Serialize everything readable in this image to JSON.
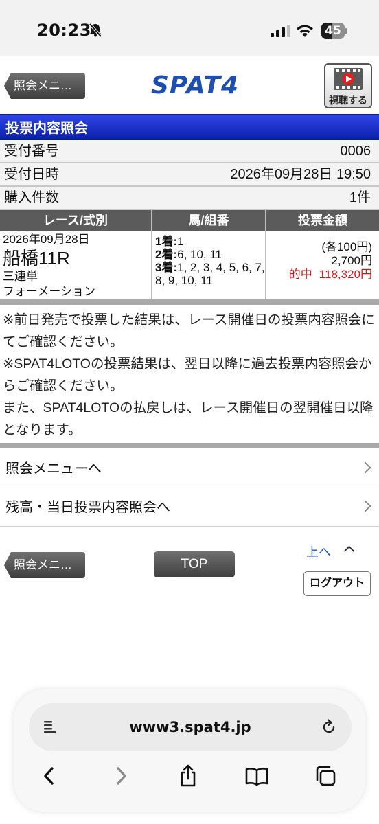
{
  "status_bar": {
    "time": "20:23",
    "battery": "45",
    "battery_level": 0.45
  },
  "header": {
    "back_button": "照会メニ…",
    "logo": "SPAT4",
    "view_button": "視聴する"
  },
  "title": "投票内容照会",
  "info": [
    {
      "label": "受付番号",
      "value": "0006"
    },
    {
      "label": "受付日時",
      "value": "2026年09月28日 19:50"
    },
    {
      "label": "購入件数",
      "value": "1件"
    }
  ],
  "table": {
    "headers": [
      "レース/式別",
      "馬/組番",
      "投票金額"
    ],
    "race_date": "2026年09月28日",
    "race_name": "船橋11R",
    "bet_type": "三連単",
    "bet_method": "フォーメーション",
    "horses": [
      {
        "pos": "1着:",
        "nums": "1"
      },
      {
        "pos": "2着:",
        "nums": "6, 10, 11"
      },
      {
        "pos": "3着:",
        "nums": "1, 2, 3, 4, 5, 6, 7, 8, 9, 10, 11"
      }
    ],
    "amount_each": "(各100円)",
    "amount_total": "2,700円",
    "hit_label": "的中",
    "hit_amount": "118,320円"
  },
  "notes": [
    "※前日発売で投票した結果は、レース開催日の投票内容照会にてご確認ください。",
    "※SPAT4LOTOの投票結果は、翌日以降に過去投票内容照会からご確認ください。",
    "また、SPAT4LOTOの払戻しは、レース開催日の翌開催日以降となります。"
  ],
  "menu_links": [
    "照会メニューへ",
    "残高・当日投票内容照会へ"
  ],
  "footer_nav": {
    "back_button": "照会メニ…",
    "top_button": "TOP",
    "up_link": "上へ",
    "logout_button": "ログアウト"
  },
  "browser": {
    "url": "www3.spat4.jp"
  }
}
